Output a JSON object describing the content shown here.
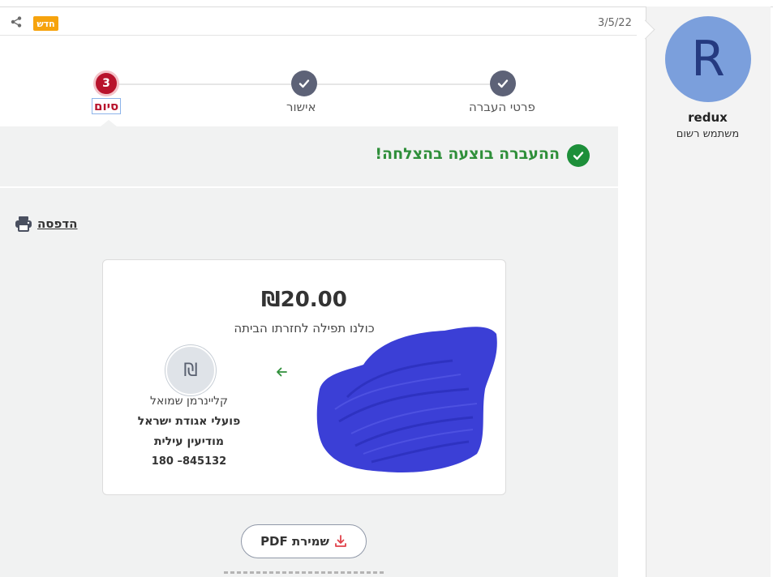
{
  "post": {
    "date": "3/5/22",
    "new_badge": "חדש",
    "share_icon": "share-icon"
  },
  "user": {
    "avatar_letter": "R",
    "avatar_color": "#7b9fdc",
    "name": "redux",
    "role": "משתמש רשום"
  },
  "stepper": {
    "current_step": 3,
    "steps": [
      {
        "label": "פרטי העברה",
        "status": "done"
      },
      {
        "label": "אישור",
        "status": "done"
      },
      {
        "label": "סיום",
        "status": "current",
        "number": "3"
      }
    ]
  },
  "success": {
    "message": "ההעברה בוצעה בהצלחה!",
    "color": "#1d8f3a"
  },
  "print": {
    "label": "הדפסה"
  },
  "receipt": {
    "amount": "₪20.00",
    "note": "כולנו תפילה לחזרתו הביתה",
    "recipient_icon": "₪",
    "recipient_name": "קליינרמן שמואל",
    "recipient_org": "פועלי אגודת ישראל",
    "recipient_city": "מודיעין עילית",
    "recipient_id": "180 –845132"
  },
  "pdf": {
    "label": "שמירת PDF"
  },
  "colors": {
    "accent_red": "#b8132c",
    "step_done": "#5d6277",
    "badge_orange": "#f6a30d",
    "redaction_blue": "#3b3fd6"
  }
}
